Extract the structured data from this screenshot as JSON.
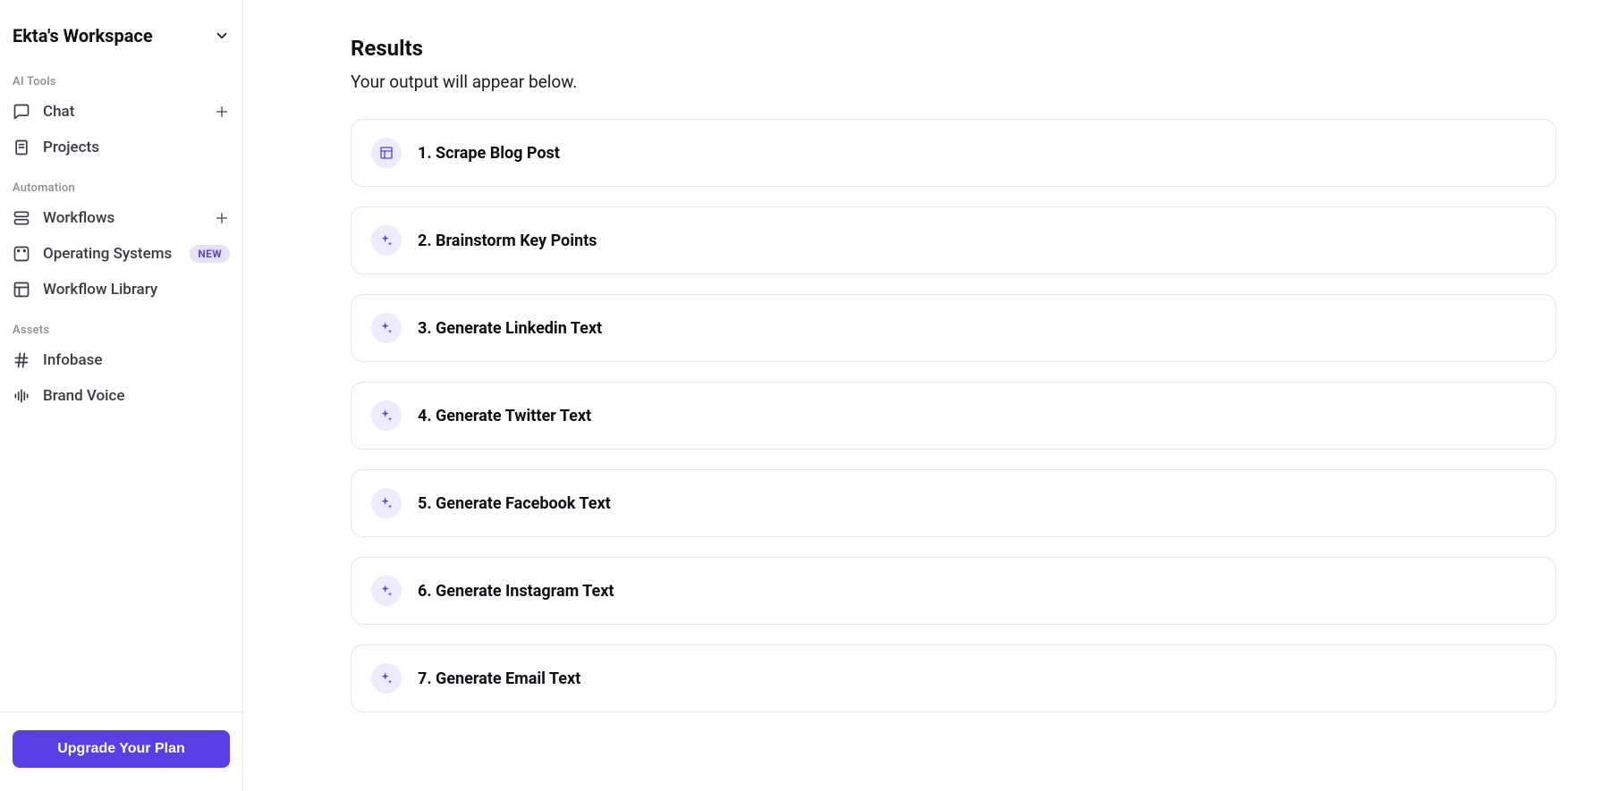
{
  "sidebar": {
    "workspace_name": "Ekta's Workspace",
    "sections": {
      "ai_tools_label": "AI Tools",
      "automation_label": "Automation",
      "assets_label": "Assets"
    },
    "items": {
      "chat": "Chat",
      "projects": "Projects",
      "workflows": "Workflows",
      "operating_systems": "Operating Systems",
      "workflow_library": "Workflow Library",
      "infobase": "Infobase",
      "brand_voice": "Brand Voice"
    },
    "new_badge": "NEW",
    "upgrade_label": "Upgrade Your Plan"
  },
  "main": {
    "title": "Results",
    "subtitle": "Your output will appear below.",
    "steps": [
      {
        "label": "1. Scrape Blog Post",
        "icon": "layout"
      },
      {
        "label": "2. Brainstorm Key Points",
        "icon": "sparkle"
      },
      {
        "label": "3. Generate Linkedin Text",
        "icon": "sparkle"
      },
      {
        "label": "4. Generate Twitter Text",
        "icon": "sparkle"
      },
      {
        "label": "5. Generate Facebook Text",
        "icon": "sparkle"
      },
      {
        "label": "6. Generate Instagram Text",
        "icon": "sparkle"
      },
      {
        "label": "7. Generate Email Text",
        "icon": "sparkle"
      }
    ]
  }
}
